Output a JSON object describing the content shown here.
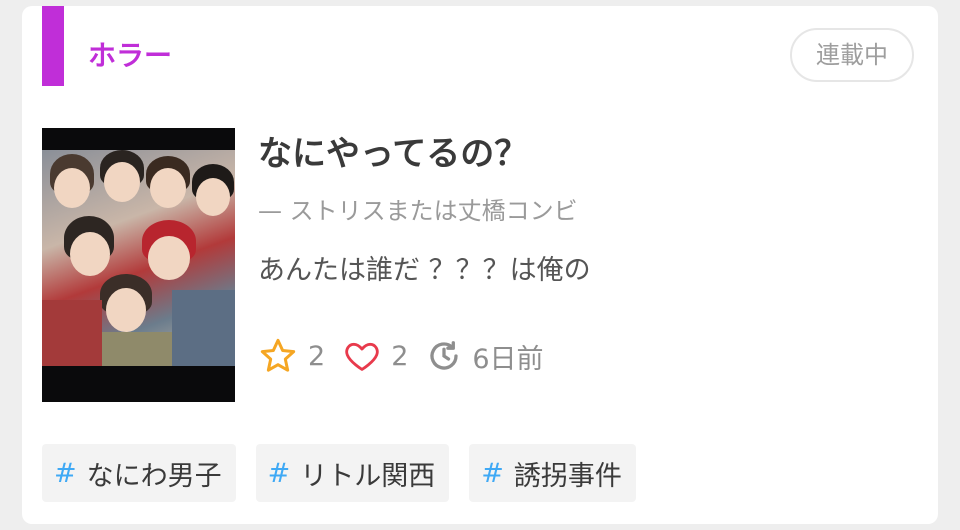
{
  "story": {
    "genre": "ホラー",
    "status": "連載中",
    "title": "なにやってるの？",
    "author": "— ストリスまたは丈橋コンビ",
    "summary": "あんたは誰だ ？？？は俺の",
    "stats": {
      "stars": "2",
      "likes": "2",
      "updated": "6日前"
    },
    "tags": [
      {
        "hash": "#",
        "label": "なにわ男子"
      },
      {
        "hash": "#",
        "label": "リトル関西"
      },
      {
        "hash": "#",
        "label": "誘拐事件"
      }
    ]
  },
  "colors": {
    "accent": "#c02ed8",
    "star": "#f5a623",
    "heart": "#e83a4c",
    "tag_hash": "#3fa9f5"
  },
  "icons": {
    "star": "star-icon",
    "heart": "heart-icon",
    "clock": "history-clock-icon",
    "thumbnail": "group-photo-thumbnail"
  }
}
